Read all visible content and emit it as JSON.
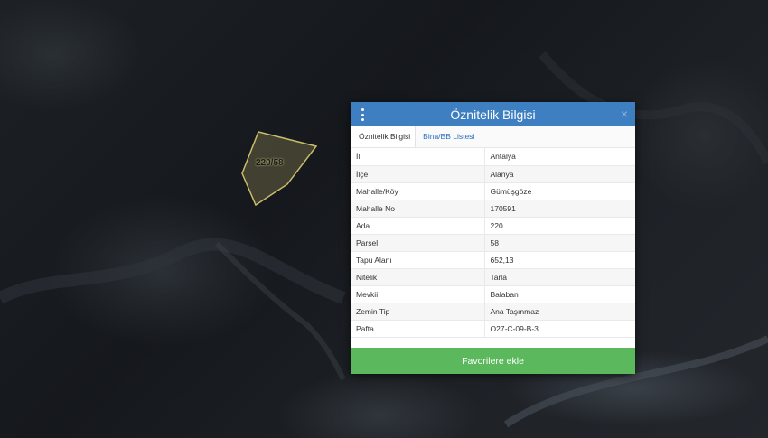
{
  "map": {
    "parcel_label": "220/58"
  },
  "popup": {
    "title": "Öznitelik Bilgisi",
    "close_symbol": "×",
    "menu_icon": "vertical-ellipsis-icon",
    "tabs": [
      {
        "label": "Öznitelik Bilgisi"
      },
      {
        "label": "Bina/BB Listesi"
      }
    ],
    "rows": [
      {
        "key": "İl",
        "value": "Antalya"
      },
      {
        "key": "İlçe",
        "value": "Alanya"
      },
      {
        "key": "Mahalle/Köy",
        "value": "Gümüşgöze"
      },
      {
        "key": "Mahalle No",
        "value": "170591"
      },
      {
        "key": "Ada",
        "value": "220"
      },
      {
        "key": "Parsel",
        "value": "58"
      },
      {
        "key": "Tapu Alanı",
        "value": "652,13"
      },
      {
        "key": "Nitelik",
        "value": "Tarla"
      },
      {
        "key": "Mevkii",
        "value": "Balaban"
      },
      {
        "key": "Zemin Tip",
        "value": "Ana Taşınmaz"
      },
      {
        "key": "Pafta",
        "value": "O27-C-09-B-3"
      }
    ],
    "favorite_button": "Favorilere ekle"
  },
  "colors": {
    "header": "#3d7fc1",
    "button": "#5cb85c",
    "parcel_outline": "#c9bd6a"
  }
}
